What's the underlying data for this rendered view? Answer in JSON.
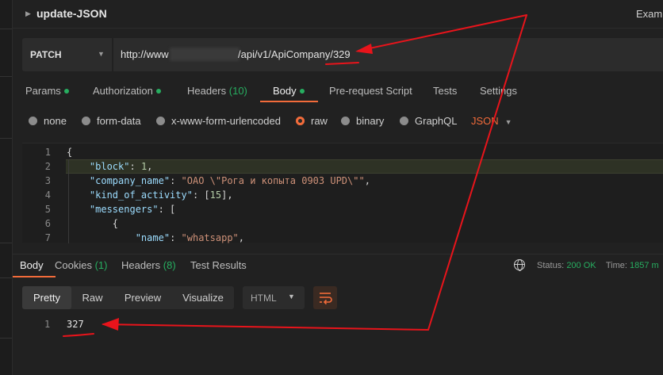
{
  "title_bar": {
    "title": "update-JSON",
    "examples_label": "Examp"
  },
  "request": {
    "method": "PATCH",
    "url_prefix": "http://www",
    "url_suffix": "/api/v1/ApiCompany/329"
  },
  "request_tabs": [
    {
      "label": "Params",
      "dot": true
    },
    {
      "label": "Authorization",
      "dot": true
    },
    {
      "label": "Headers",
      "count": "(10)"
    },
    {
      "label": "Body",
      "dot": true,
      "active": true
    },
    {
      "label": "Pre-request Script"
    },
    {
      "label": "Tests"
    },
    {
      "label": "Settings"
    }
  ],
  "body_options": {
    "none": "none",
    "form_data": "form-data",
    "urlencoded": "x-www-form-urlencoded",
    "raw": "raw",
    "binary": "binary",
    "graphql": "GraphQL",
    "format": "JSON",
    "selected": "raw"
  },
  "editor": {
    "line_numbers": [
      "1",
      "2",
      "3",
      "4",
      "5",
      "6",
      "7"
    ],
    "lines": [
      "{",
      "    \"block\": 1,",
      "    \"company_name\": \"ОАО \\\"Рога и копыта 0903 UPD\\\"\",",
      "    \"kind_of_activity\": [15],",
      "    \"messengers\": [",
      "        {",
      "            \"name\": \"whatsapp\","
    ]
  },
  "response_tabs": {
    "body": "Body",
    "cookies": "Cookies",
    "cookies_count": "(1)",
    "headers": "Headers",
    "headers_count": "(8)",
    "test_results": "Test Results"
  },
  "response_status": {
    "status_label": "Status:",
    "status_value": "200 OK",
    "time_label": "Time:",
    "time_value": "1857 m"
  },
  "view_modes": [
    "Pretty",
    "Raw",
    "Preview",
    "Visualize"
  ],
  "active_view": "Pretty",
  "response_format": "HTML",
  "response": {
    "line_number": "1",
    "value": "327"
  },
  "colors": {
    "accent": "#f26b3a",
    "success": "#27ae60",
    "annotation": "#e8141b"
  }
}
